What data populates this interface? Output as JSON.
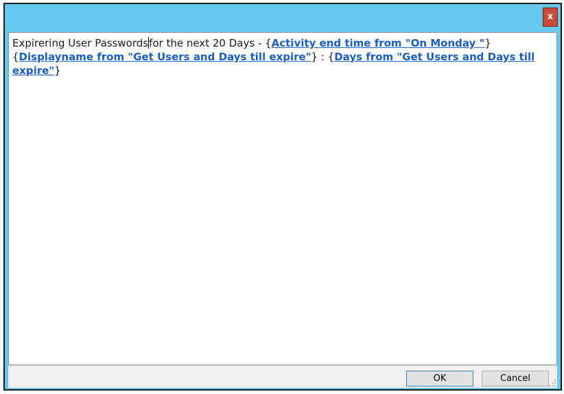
{
  "window": {
    "close_glyph": "x",
    "border_color": "#1a1a1a",
    "title_color": "#65c8ec"
  },
  "editor": {
    "text_before_caret": "Expirering User Passwords",
    "text_after_caret": "for the next 20 Days - {",
    "token1": "Activity end time from \"On Monday \"",
    "brace_close1": "}",
    "brace_open2": "{",
    "token2": "Displayname from \"Get Users and Days till expire\"",
    "separator": "} : {",
    "token3": "Days from \"Get Users and Days till expire\"",
    "brace_close3": "}",
    "token_color": "#1a5fc2"
  },
  "footer": {
    "ok_label": "OK",
    "cancel_label": "Cancel"
  }
}
